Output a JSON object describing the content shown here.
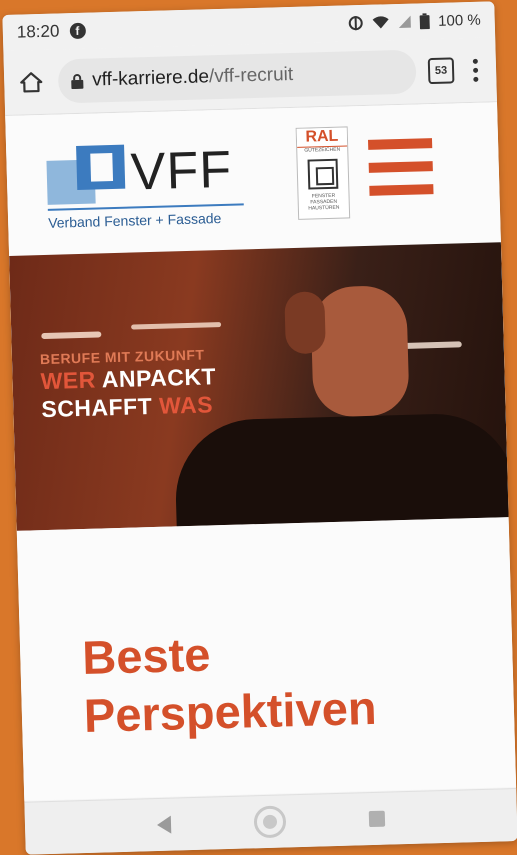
{
  "status_bar": {
    "time": "18:20",
    "battery": "100 %"
  },
  "browser": {
    "url_host": "vff-karriere.de",
    "url_path": "/vff-recruit",
    "tab_count": "53"
  },
  "site": {
    "logo_text": "VFF",
    "logo_tagline": "Verband Fenster + Fassade",
    "ral_label": "RAL",
    "ral_subtext": "GÜTEZEICHEN",
    "ral_footer": "FENSTER FASSADEN HAUSTÜREN"
  },
  "hero": {
    "kicker": "BERUFE MIT ZUKUNFT",
    "line1_part1": "WER",
    "line1_part2": "ANPACKT",
    "line2_part1": "SCHAFFT",
    "line2_part2": "WAS"
  },
  "content": {
    "headline_line1": "Beste",
    "headline_line2": "Perspektiven"
  },
  "colors": {
    "accent": "#d4502a",
    "logo_blue": "#3c7bbf",
    "background": "#d9772a"
  }
}
